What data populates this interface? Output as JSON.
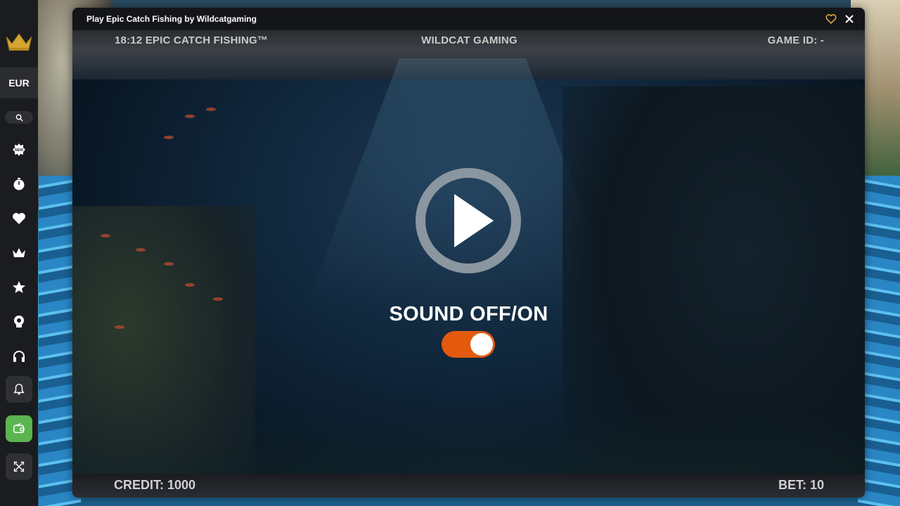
{
  "window": {
    "title": "Play Epic Catch Fishing by Wildcatgaming",
    "favorite_icon": "heart-outline-icon",
    "close_icon": "close-icon"
  },
  "sidebar": {
    "logo_icon": "crown-logo-icon",
    "currency": "EUR",
    "search_icon": "search-icon",
    "items": [
      {
        "icon": "new-badge-icon"
      },
      {
        "icon": "stopwatch-icon"
      },
      {
        "icon": "heart-icon"
      },
      {
        "icon": "crown-icon"
      },
      {
        "icon": "star-icon"
      },
      {
        "icon": "trophy-icon"
      },
      {
        "icon": "headset-icon"
      }
    ],
    "bottom": [
      {
        "icon": "bell-icon"
      },
      {
        "icon": "wallet-icon",
        "color": "#5bb450"
      },
      {
        "icon": "fullscreen-icon"
      }
    ]
  },
  "game": {
    "hud": {
      "left": "18:12 EPIC CATCH FISHING™",
      "center": "WILDCAT GAMING",
      "right": "GAME ID: -",
      "credit": "CREDIT: 1000",
      "bet": "BET: 10"
    },
    "play_icon": "play-circle-icon",
    "sound_label": "SOUND OFF/ON",
    "sound_enabled": true,
    "toggle_color": "#e35a0f"
  }
}
